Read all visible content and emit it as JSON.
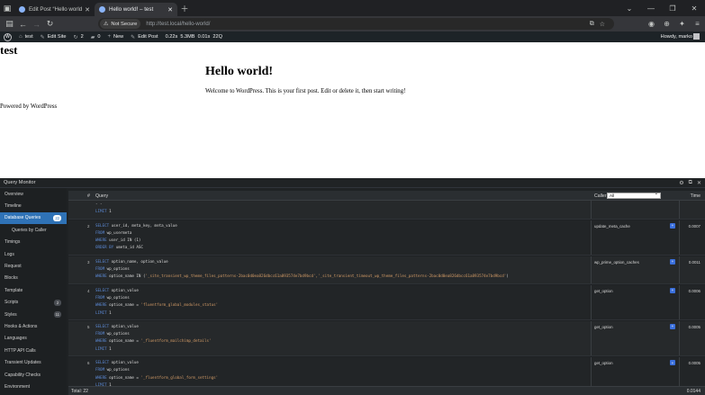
{
  "browser": {
    "tabs": [
      {
        "title": "Edit Post “Hello world!” - test —",
        "active": false
      },
      {
        "title": "Hello world! – test",
        "active": true
      }
    ],
    "not_secure_label": "Not Secure",
    "url_host": "http://test.local",
    "url_path": "/hello-world/"
  },
  "adminbar": {
    "site": "test",
    "edit_site": "Edit Site",
    "updates": "2",
    "comments": "0",
    "new": "New",
    "edit_post": "Edit Post",
    "qm_stats": "0.22s  5.3MB  0.01s  22Q",
    "howdy": "Howdy, marko"
  },
  "page": {
    "site_title": "test",
    "post_title": "Hello world!",
    "post_body": "Welcome to WordPress. This is your first post. Edit or delete it, then start writing!",
    "footer": "Powered by WordPress"
  },
  "qm": {
    "title": "Query Monitor",
    "nav": [
      {
        "label": "Overview"
      },
      {
        "label": "Timeline"
      },
      {
        "label": "Database Queries",
        "count": "22",
        "selected": true
      },
      {
        "label": "Queries by Caller",
        "sub": true
      },
      {
        "label": "Timings"
      },
      {
        "label": "Logs"
      },
      {
        "label": "Request"
      },
      {
        "label": "Blocks"
      },
      {
        "label": "Template"
      },
      {
        "label": "Scripts",
        "count": "2"
      },
      {
        "label": "Styles",
        "count": "11"
      },
      {
        "label": "Hooks & Actions"
      },
      {
        "label": "Languages"
      },
      {
        "label": "HTTP API Calls"
      },
      {
        "label": "Transient Updates"
      },
      {
        "label": "Capability Checks"
      },
      {
        "label": "Environment"
      }
    ],
    "headers": {
      "num": "#",
      "query": "Query",
      "caller": "Caller",
      "caller_filter": "All",
      "time": "Time"
    },
    "rows": [
      {
        "num": "",
        "lines": [
          [
            "",
            "- -"
          ],
          [
            "kw:LIMIT",
            " 1"
          ]
        ],
        "caller": "",
        "time": ""
      },
      {
        "num": "2",
        "lines": [
          [
            "kw:SELECT",
            " user_id, meta_key, meta_value"
          ],
          [
            "kw:FROM",
            " wp_usermeta"
          ],
          [
            "kw:WHERE",
            " user_id IN (1)"
          ],
          [
            "kw:ORDER BY",
            " umeta_id ASC"
          ]
        ],
        "caller": "update_meta_cache",
        "time": "0.0007"
      },
      {
        "num": "3",
        "lines": [
          [
            "kw:SELECT",
            " option_name, option_value"
          ],
          [
            "kw:FROM",
            " wp_options"
          ],
          [
            "kw:WHERE",
            " option_name IN ('_site_transient_wp_theme_files_patterns-2bac0d0ea826dbcc61a893574e7bd9bcd','_site_transient_timeout_wp_theme_files_patterns-2bac0d0ea826dbcc61a893574e7bd9bcd')"
          ]
        ],
        "caller": "wp_prime_option_caches",
        "time": "0.0011"
      },
      {
        "num": "4",
        "lines": [
          [
            "kw:SELECT",
            " option_value"
          ],
          [
            "kw:FROM",
            " wp_options"
          ],
          [
            "kw:WHERE",
            " option_name = 'fluentform_global_modules_status'"
          ],
          [
            "kw:LIMIT",
            " 1"
          ]
        ],
        "caller": "get_option",
        "time": "0.0006"
      },
      {
        "num": "5",
        "lines": [
          [
            "kw:SELECT",
            " option_value"
          ],
          [
            "kw:FROM",
            " wp_options"
          ],
          [
            "kw:WHERE",
            " option_name = '_fluentform_mailchimp_details'"
          ],
          [
            "kw:LIMIT",
            " 1"
          ]
        ],
        "caller": "get_option",
        "time": "0.0005"
      },
      {
        "num": "6",
        "lines": [
          [
            "kw:SELECT",
            " option_value"
          ],
          [
            "kw:FROM",
            " wp_options"
          ],
          [
            "kw:WHERE",
            " option_name = '_fluentform_global_form_settings'"
          ],
          [
            "kw:LIMIT",
            " 1"
          ]
        ],
        "caller": "get_option",
        "time": "0.0005"
      }
    ],
    "footer": {
      "total": "Total: 22",
      "time": "0.0144"
    }
  }
}
